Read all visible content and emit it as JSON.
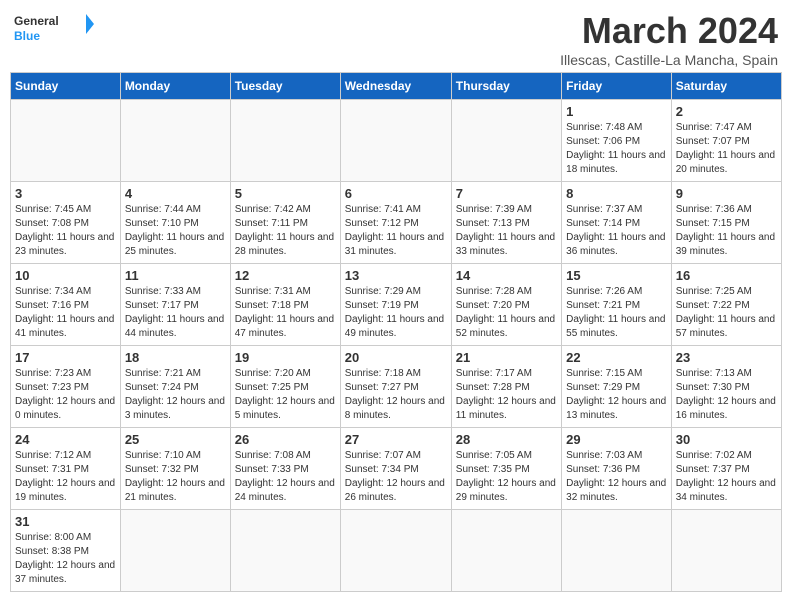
{
  "header": {
    "logo_general": "General",
    "logo_blue": "Blue",
    "month_title": "March 2024",
    "subtitle": "Illescas, Castille-La Mancha, Spain"
  },
  "days_of_week": [
    "Sunday",
    "Monday",
    "Tuesday",
    "Wednesday",
    "Thursday",
    "Friday",
    "Saturday"
  ],
  "weeks": [
    [
      {
        "day": "",
        "info": ""
      },
      {
        "day": "",
        "info": ""
      },
      {
        "day": "",
        "info": ""
      },
      {
        "day": "",
        "info": ""
      },
      {
        "day": "",
        "info": ""
      },
      {
        "day": "1",
        "info": "Sunrise: 7:48 AM\nSunset: 7:06 PM\nDaylight: 11 hours and 18 minutes."
      },
      {
        "day": "2",
        "info": "Sunrise: 7:47 AM\nSunset: 7:07 PM\nDaylight: 11 hours and 20 minutes."
      }
    ],
    [
      {
        "day": "3",
        "info": "Sunrise: 7:45 AM\nSunset: 7:08 PM\nDaylight: 11 hours and 23 minutes."
      },
      {
        "day": "4",
        "info": "Sunrise: 7:44 AM\nSunset: 7:10 PM\nDaylight: 11 hours and 25 minutes."
      },
      {
        "day": "5",
        "info": "Sunrise: 7:42 AM\nSunset: 7:11 PM\nDaylight: 11 hours and 28 minutes."
      },
      {
        "day": "6",
        "info": "Sunrise: 7:41 AM\nSunset: 7:12 PM\nDaylight: 11 hours and 31 minutes."
      },
      {
        "day": "7",
        "info": "Sunrise: 7:39 AM\nSunset: 7:13 PM\nDaylight: 11 hours and 33 minutes."
      },
      {
        "day": "8",
        "info": "Sunrise: 7:37 AM\nSunset: 7:14 PM\nDaylight: 11 hours and 36 minutes."
      },
      {
        "day": "9",
        "info": "Sunrise: 7:36 AM\nSunset: 7:15 PM\nDaylight: 11 hours and 39 minutes."
      }
    ],
    [
      {
        "day": "10",
        "info": "Sunrise: 7:34 AM\nSunset: 7:16 PM\nDaylight: 11 hours and 41 minutes."
      },
      {
        "day": "11",
        "info": "Sunrise: 7:33 AM\nSunset: 7:17 PM\nDaylight: 11 hours and 44 minutes."
      },
      {
        "day": "12",
        "info": "Sunrise: 7:31 AM\nSunset: 7:18 PM\nDaylight: 11 hours and 47 minutes."
      },
      {
        "day": "13",
        "info": "Sunrise: 7:29 AM\nSunset: 7:19 PM\nDaylight: 11 hours and 49 minutes."
      },
      {
        "day": "14",
        "info": "Sunrise: 7:28 AM\nSunset: 7:20 PM\nDaylight: 11 hours and 52 minutes."
      },
      {
        "day": "15",
        "info": "Sunrise: 7:26 AM\nSunset: 7:21 PM\nDaylight: 11 hours and 55 minutes."
      },
      {
        "day": "16",
        "info": "Sunrise: 7:25 AM\nSunset: 7:22 PM\nDaylight: 11 hours and 57 minutes."
      }
    ],
    [
      {
        "day": "17",
        "info": "Sunrise: 7:23 AM\nSunset: 7:23 PM\nDaylight: 12 hours and 0 minutes."
      },
      {
        "day": "18",
        "info": "Sunrise: 7:21 AM\nSunset: 7:24 PM\nDaylight: 12 hours and 3 minutes."
      },
      {
        "day": "19",
        "info": "Sunrise: 7:20 AM\nSunset: 7:25 PM\nDaylight: 12 hours and 5 minutes."
      },
      {
        "day": "20",
        "info": "Sunrise: 7:18 AM\nSunset: 7:27 PM\nDaylight: 12 hours and 8 minutes."
      },
      {
        "day": "21",
        "info": "Sunrise: 7:17 AM\nSunset: 7:28 PM\nDaylight: 12 hours and 11 minutes."
      },
      {
        "day": "22",
        "info": "Sunrise: 7:15 AM\nSunset: 7:29 PM\nDaylight: 12 hours and 13 minutes."
      },
      {
        "day": "23",
        "info": "Sunrise: 7:13 AM\nSunset: 7:30 PM\nDaylight: 12 hours and 16 minutes."
      }
    ],
    [
      {
        "day": "24",
        "info": "Sunrise: 7:12 AM\nSunset: 7:31 PM\nDaylight: 12 hours and 19 minutes."
      },
      {
        "day": "25",
        "info": "Sunrise: 7:10 AM\nSunset: 7:32 PM\nDaylight: 12 hours and 21 minutes."
      },
      {
        "day": "26",
        "info": "Sunrise: 7:08 AM\nSunset: 7:33 PM\nDaylight: 12 hours and 24 minutes."
      },
      {
        "day": "27",
        "info": "Sunrise: 7:07 AM\nSunset: 7:34 PM\nDaylight: 12 hours and 26 minutes."
      },
      {
        "day": "28",
        "info": "Sunrise: 7:05 AM\nSunset: 7:35 PM\nDaylight: 12 hours and 29 minutes."
      },
      {
        "day": "29",
        "info": "Sunrise: 7:03 AM\nSunset: 7:36 PM\nDaylight: 12 hours and 32 minutes."
      },
      {
        "day": "30",
        "info": "Sunrise: 7:02 AM\nSunset: 7:37 PM\nDaylight: 12 hours and 34 minutes."
      }
    ],
    [
      {
        "day": "31",
        "info": "Sunrise: 8:00 AM\nSunset: 8:38 PM\nDaylight: 12 hours and 37 minutes."
      },
      {
        "day": "",
        "info": ""
      },
      {
        "day": "",
        "info": ""
      },
      {
        "day": "",
        "info": ""
      },
      {
        "day": "",
        "info": ""
      },
      {
        "day": "",
        "info": ""
      },
      {
        "day": "",
        "info": ""
      }
    ]
  ]
}
